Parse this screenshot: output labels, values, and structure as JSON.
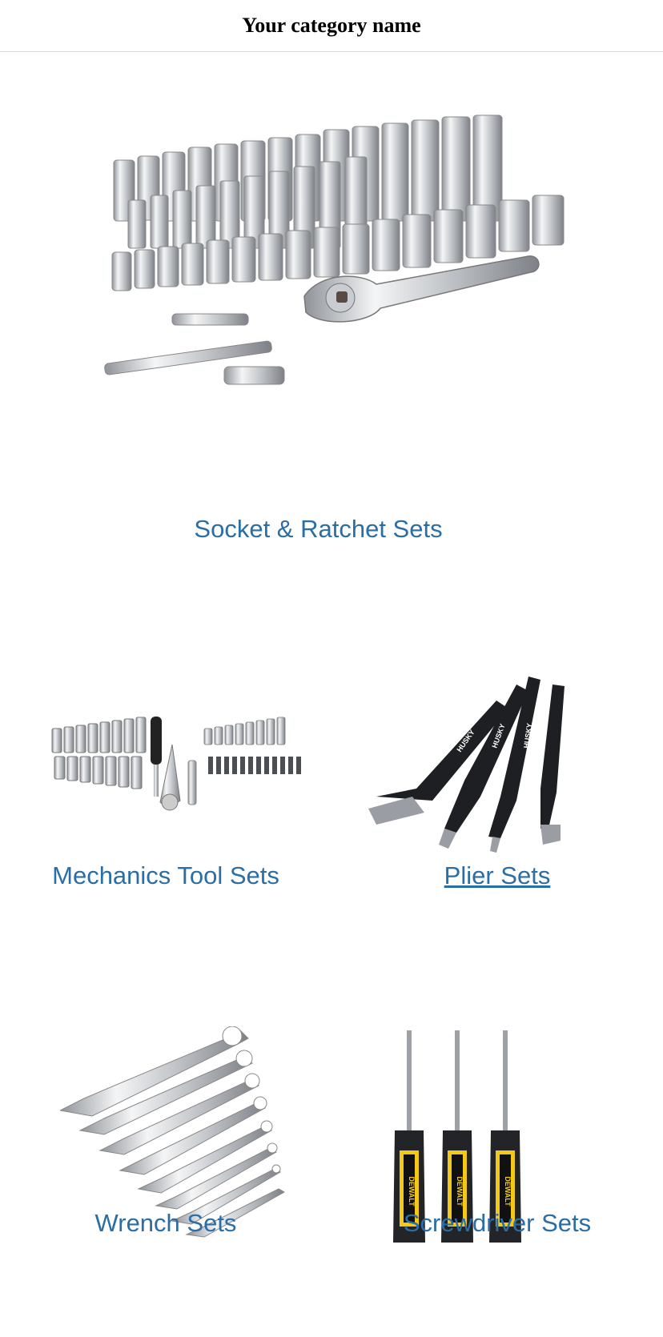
{
  "header": {
    "title": "Your category name"
  },
  "categories": [
    {
      "label": "Socket & Ratchet Sets",
      "image": "socket-ratchet-set-icon"
    },
    {
      "label": "Mechanics Tool Sets",
      "image": "mechanics-tool-set-icon"
    },
    {
      "label": "Plier Sets",
      "image": "plier-set-icon"
    },
    {
      "label": "Wrench Sets",
      "image": "wrench-set-icon"
    },
    {
      "label": "Screwdriver Sets",
      "image": "screwdriver-set-icon"
    }
  ],
  "colors": {
    "link": "#2b6ea6",
    "divider": "#d9d9d9"
  }
}
